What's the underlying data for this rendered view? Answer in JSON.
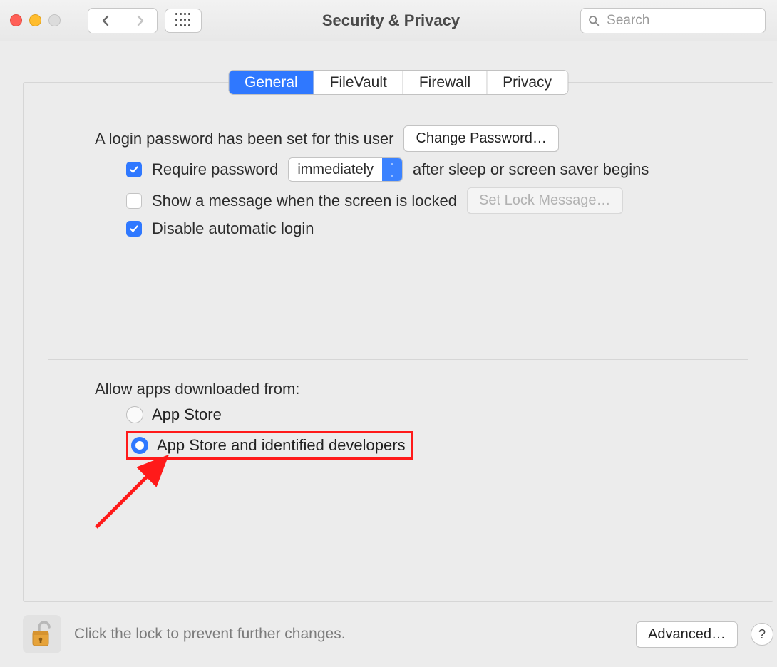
{
  "window": {
    "title": "Security & Privacy"
  },
  "search": {
    "placeholder": "Search"
  },
  "tabs": {
    "general": "General",
    "filevault": "FileVault",
    "firewall": "Firewall",
    "privacy": "Privacy"
  },
  "general": {
    "login_password_set": "A login password has been set for this user",
    "change_password": "Change Password…",
    "require_password_pre": "Require password",
    "require_password_select": "immediately",
    "require_password_post": "after sleep or screen saver begins",
    "show_message": "Show a message when the screen is locked",
    "set_lock_message": "Set Lock Message…",
    "disable_auto_login": "Disable automatic login",
    "allow_apps_from": "Allow apps downloaded from:",
    "opt_app_store": "App Store",
    "opt_identified": "App Store and identified developers"
  },
  "footer": {
    "lock_text": "Click the lock to prevent further changes.",
    "advanced": "Advanced…",
    "help": "?"
  }
}
